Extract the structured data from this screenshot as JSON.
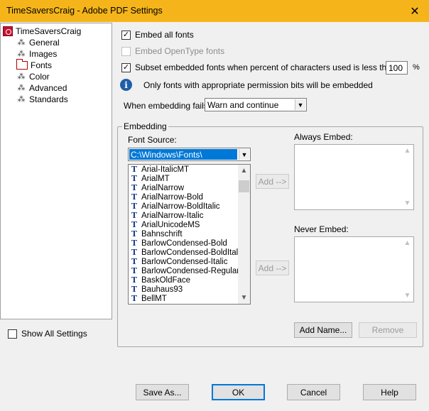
{
  "window": {
    "title": "TimeSaversCraig - Adobe PDF Settings",
    "close_glyph": "✕"
  },
  "tree": {
    "root": "TimeSaversCraig",
    "items": [
      "General",
      "Images",
      "Fonts",
      "Color",
      "Advanced",
      "Standards"
    ],
    "selected": "Fonts"
  },
  "show_all": {
    "label": "Show All Settings",
    "checked": false
  },
  "options": {
    "embed_all": {
      "label": "Embed all fonts",
      "checked": true
    },
    "embed_opentype": {
      "label": "Embed OpenType fonts",
      "checked": false,
      "enabled": false
    },
    "subset": {
      "label": "Subset embedded fonts when percent of characters used is less than:",
      "checked": true,
      "value": "100",
      "unit": "%"
    },
    "info": "Only fonts with appropriate permission bits will be embedded",
    "when_fails": {
      "label": "When embedding fails:",
      "value": "Warn and continue"
    }
  },
  "embedding": {
    "group_label": "Embedding",
    "font_source_label": "Font Source:",
    "font_source_value": "C:\\Windows\\Fonts\\",
    "fonts": [
      "Arial-ItalicMT",
      "ArialMT",
      "ArialNarrow",
      "ArialNarrow-Bold",
      "ArialNarrow-BoldItalic",
      "ArialNarrow-Italic",
      "ArialUnicodeMS",
      "Bahnschrift",
      "BarlowCondensed-Bold",
      "BarlowCondensed-BoldItalic",
      "BarlowCondensed-Italic",
      "BarlowCondensed-Regular",
      "BaskOldFace",
      "Bauhaus93",
      "BellMT"
    ],
    "always_label": "Always Embed:",
    "never_label": "Never Embed:",
    "add_button": "Add -->",
    "add_name_button": "Add Name...",
    "remove_button": "Remove"
  },
  "footer": {
    "save_as": "Save As...",
    "ok": "OK",
    "cancel": "Cancel",
    "help": "Help"
  },
  "icons": {
    "font_item": "T",
    "check": "✓",
    "dropdown": "▼",
    "scroll_up": "▲",
    "scroll_down": "▼",
    "info": "i"
  }
}
